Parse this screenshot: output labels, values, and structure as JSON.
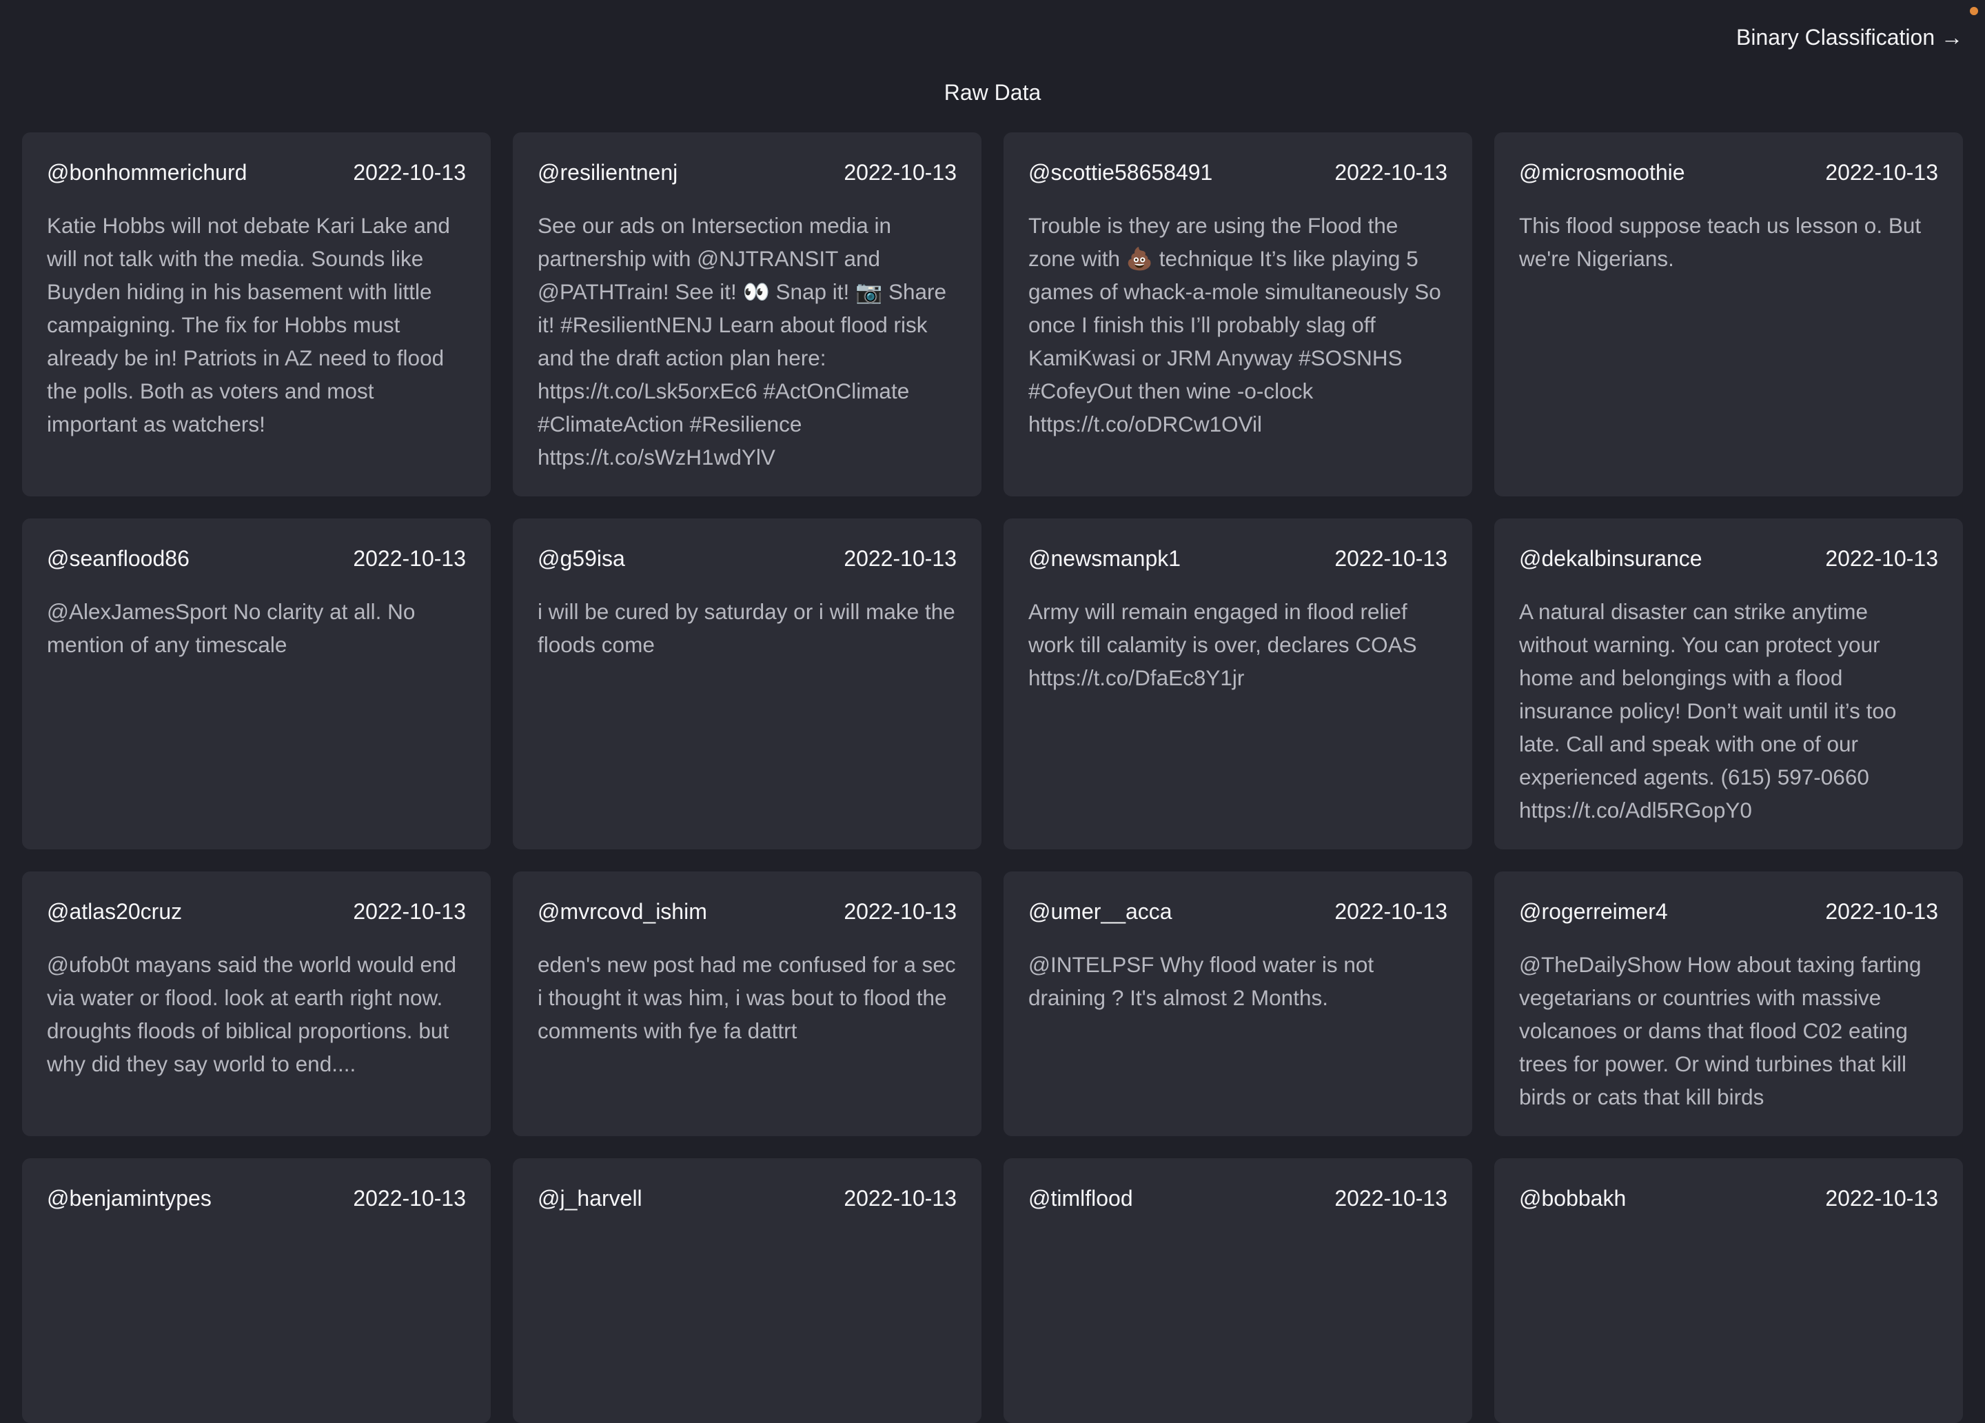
{
  "header": {
    "nav_link": "Binary Classification →",
    "page_title": "Raw Data"
  },
  "colors": {
    "background": "#1f2028",
    "card": "#2c2d36",
    "text_primary": "#f3f3f5",
    "text_secondary": "#b7b8c0",
    "status_dot": "#e28a3a"
  },
  "tweets": [
    {
      "user": "@bonhommerichurd",
      "date": "2022-10-13",
      "text": "Katie Hobbs will not debate Kari Lake and will not talk with the media. Sounds like Buyden hiding in his basement with little campaigning. The fix for Hobbs must already be in! Patriots in AZ need to flood the polls. Both as voters and most important as watchers!"
    },
    {
      "user": "@resilientnenj",
      "date": "2022-10-13",
      "text": "See our ads on Intersection media in partnership with @NJTRANSIT and @PATHTrain! See it! 👀 Snap it! 📷 Share it! #ResilientNENJ Learn about flood risk and the draft action plan here: https://t.co/Lsk5orxEc6 #ActOnClimate #ClimateAction #Resilience https://t.co/sWzH1wdYlV"
    },
    {
      "user": "@scottie58658491",
      "date": "2022-10-13",
      "text": "Trouble is they are using the Flood the zone with 💩 technique It’s like playing 5 games of whack-a-mole simultaneously So once I finish this I’ll probably slag off KamiKwasi or JRM Anyway #SOSNHS #CofeyOut then wine -o-clock https://t.co/oDRCw1OVil"
    },
    {
      "user": "@microsmoothie",
      "date": "2022-10-13",
      "text": "This flood suppose teach us lesson o. But we're Nigerians."
    },
    {
      "user": "@seanflood86",
      "date": "2022-10-13",
      "text": "@AlexJamesSport No clarity at all. No mention of any timescale"
    },
    {
      "user": "@g59isa",
      "date": "2022-10-13",
      "text": "i will be cured by saturday or i will make the floods come"
    },
    {
      "user": "@newsmanpk1",
      "date": "2022-10-13",
      "text": "Army will remain engaged in flood relief work till calamity is over, declares COAS https://t.co/DfaEc8Y1jr"
    },
    {
      "user": "@dekalbinsurance",
      "date": "2022-10-13",
      "text": "A natural disaster can strike anytime without warning. You can protect your home and belongings with a flood insurance policy! Don’t wait until it’s too late. Call and speak with one of our experienced agents. (615) 597-0660 https://t.co/Adl5RGopY0"
    },
    {
      "user": "@atlas20cruz",
      "date": "2022-10-13",
      "text": "@ufob0t mayans said the world would end via water or flood. look at earth right now. droughts floods of biblical proportions. but why did they say world to end...."
    },
    {
      "user": "@mvrcovd_ishim",
      "date": "2022-10-13",
      "text": "eden's new post had me confused for a sec i thought it was him, i was bout to flood the comments with fye fa dattrt"
    },
    {
      "user": "@umer__acca",
      "date": "2022-10-13",
      "text": "@INTELPSF Why flood water is not draining ? It's almost 2 Months."
    },
    {
      "user": "@rogerreimer4",
      "date": "2022-10-13",
      "text": "@TheDailyShow How about taxing farting vegetarians or countries with massive volcanoes or dams that flood C02 eating trees for power. Or wind turbines that kill birds or cats that kill birds"
    },
    {
      "user": "@benjamintypes",
      "date": "2022-10-13",
      "text": ""
    },
    {
      "user": "@j_harvell",
      "date": "2022-10-13",
      "text": ""
    },
    {
      "user": "@timlflood",
      "date": "2022-10-13",
      "text": ""
    },
    {
      "user": "@bobbakh",
      "date": "2022-10-13",
      "text": ""
    }
  ]
}
